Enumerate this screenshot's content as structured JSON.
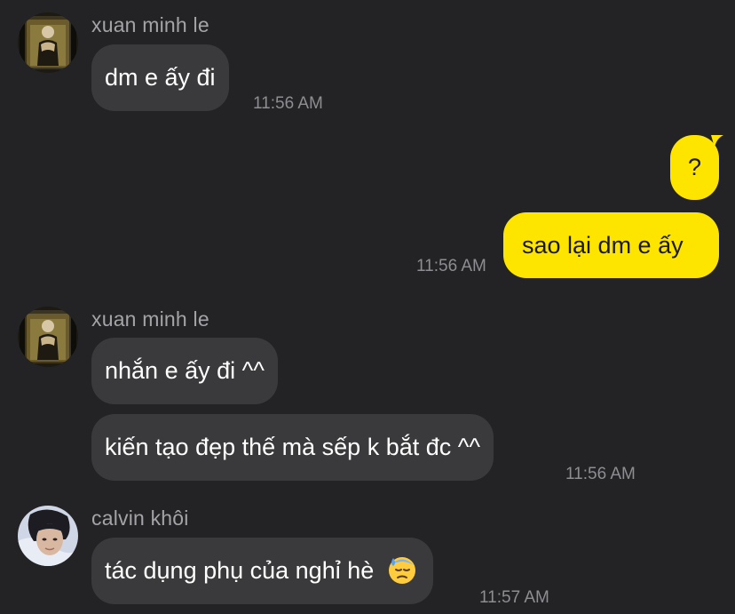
{
  "colors": {
    "background": "#232325",
    "incoming_bubble": "#3a3a3c",
    "outgoing_bubble": "#fee500",
    "sender_name": "#a4a4a8",
    "timestamp": "#8d8d92"
  },
  "messages": [
    {
      "group": "xuan-1",
      "sender": "xuan minh le",
      "avatar_icon": "user-photo-avatar",
      "bubbles": [
        "dm e ấy đi"
      ],
      "time": "11:56 AM"
    },
    {
      "group": "me-1",
      "sender": "",
      "outgoing": true,
      "bubbles": [
        "?",
        "sao lại dm e ấy"
      ],
      "time": "11:56 AM"
    },
    {
      "group": "xuan-2",
      "sender": "xuan minh le",
      "avatar_icon": "user-photo-avatar",
      "bubbles": [
        "nhắn e ấy đi ^^",
        "kiến tạo đẹp thế mà sếp k bắt đc ^^"
      ],
      "time": "11:56 AM"
    },
    {
      "group": "calvin-1",
      "sender": "calvin khôi",
      "avatar_icon": "user-photo-avatar",
      "bubbles": [
        "tác dụng phụ của nghỉ hè"
      ],
      "emoji_icon": "downcast-face-with-sweat-emoji",
      "time": "11:57 AM"
    }
  ]
}
